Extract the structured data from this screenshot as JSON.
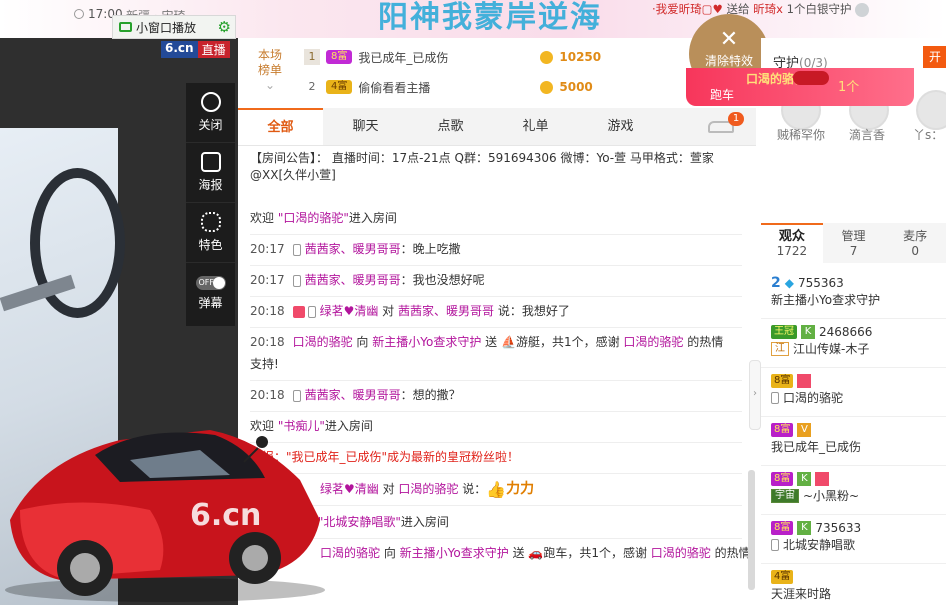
{
  "topbar": {
    "time": "17:00",
    "faded_text": "新疆 · 宋琦",
    "banner_title": "阳神我蒙岸逆海",
    "gift_msg": {
      "prefix": "·我爱昕琦▢♥",
      "verb": " 送给 ",
      "target": "昕琦x",
      "suffix": " 1个白银守护"
    }
  },
  "mini_window": {
    "label": "小窗口播放"
  },
  "video": {
    "logo": "6.cn",
    "logo_tag": "直播",
    "tools": [
      {
        "icon": "power-icon",
        "label": "关闭"
      },
      {
        "icon": "poster-icon",
        "label": "海报"
      },
      {
        "icon": "effects-icon",
        "label": "特色"
      },
      {
        "icon": "toggle-icon",
        "label": "弹幕",
        "toggle_text": "OFF"
      }
    ]
  },
  "rank": {
    "side_label_1": "本场",
    "side_label_2": "榜单",
    "rows": [
      {
        "num": "1",
        "level": "8富",
        "name": "我已成年_已成伤",
        "value": "10250"
      },
      {
        "num": "2",
        "level": "4富",
        "name": "偷偷看看主播",
        "value": "5000"
      }
    ]
  },
  "tabs": [
    "全部",
    "聊天",
    "点歌",
    "礼单",
    "游戏"
  ],
  "car_badge": "1",
  "notice": "【房间公告】： 直播时间：17点-21点 Q群：591694306 微博：Yo-萱 马甲格式：萱家@XX[久伴小萱]",
  "chat": [
    {
      "kind": "welcome",
      "pre": "欢迎 ",
      "user": "\"口渴的骆驼\"",
      "post": "进入房间"
    },
    {
      "kind": "msg",
      "time": "20:17",
      "user": "茜茜家、暖男哥哥",
      "text": "：晚上吃撒"
    },
    {
      "kind": "msg",
      "time": "20:17",
      "user": "茜茜家、暖男哥哥",
      "text": "：我也没想好呢"
    },
    {
      "kind": "msg2",
      "time": "20:18",
      "user": "绿茗♥清幽",
      "mid": " 对 ",
      "user2": "茜茜家、暖男哥哥",
      "text": " 说：我想好了"
    },
    {
      "kind": "gift",
      "time": "20:18",
      "user": "口渴的骆驼",
      "mid": " 向 ",
      "user2": "新主播小Yo查求守护",
      "text": " 送 ",
      "item": "游艇，共1个，感谢 ",
      "user3": "口渴的骆驼",
      "end": " 的热情",
      "line2": "支持!"
    },
    {
      "kind": "msg",
      "time": "20:18",
      "user": "茜茜家、暖男哥哥",
      "text": "：想的撒？"
    },
    {
      "kind": "welcome",
      "pre": "欢迎 ",
      "user": "\"书痴儿\"",
      "post": "进入房间"
    },
    {
      "kind": "alert",
      "text": "快报：\"我已成年_已成伤\"成为最新的皇冠粉丝啦！"
    },
    {
      "kind": "msg3",
      "user": "绿茗♥清幽",
      "mid": " 对 ",
      "user2": "口渴的骆驼",
      "text": " 说：",
      "kk": "力力"
    },
    {
      "kind": "welcome",
      "pre": "欢迎 ",
      "user": "\"北城安静唱歌\"",
      "post": "进入房间"
    },
    {
      "kind": "gift",
      "time": "",
      "user": "口渴的骆驼",
      "mid": " 向 ",
      "user2": "新主播小Yo查求守护",
      "text": " 送 ",
      "item": "跑车，共1个，感谢 ",
      "user3": "口渴的骆驼",
      "end": " 的热情",
      "line2": ""
    }
  ],
  "clear_effects": {
    "label": "清除特效"
  },
  "car_banner": {
    "name": "口渴的骆驼",
    "gift": "跑车",
    "count": "1个"
  },
  "guard": {
    "label": "守护",
    "count": "(0/3)",
    "open_btn": "开"
  },
  "guard_names": [
    "贼稀罕你",
    "滴言香",
    "丫s："
  ],
  "right_tabs": [
    {
      "label": "观众",
      "sub": "1722"
    },
    {
      "label": "管理",
      "sub": "7"
    },
    {
      "label": "麦序",
      "sub": "0"
    }
  ],
  "viewers": [
    {
      "badge": "2",
      "id": "755363",
      "name": "新主播小Yo查求守护"
    },
    {
      "badge": "王冠",
      "id": "2468666",
      "tag": "江",
      "name": "江山传媒-木子"
    },
    {
      "badge": "8富",
      "name": "口渴的骆驼"
    },
    {
      "badge": "8富",
      "name": "我已成年_已成伤"
    },
    {
      "badge": "8富",
      "tag": "宇宙",
      "name": "~小黑粉~"
    },
    {
      "badge": "8富",
      "id": "735633",
      "name": "北城安静唱歌"
    },
    {
      "badge": "4富",
      "name": "天涯来时路"
    }
  ]
}
